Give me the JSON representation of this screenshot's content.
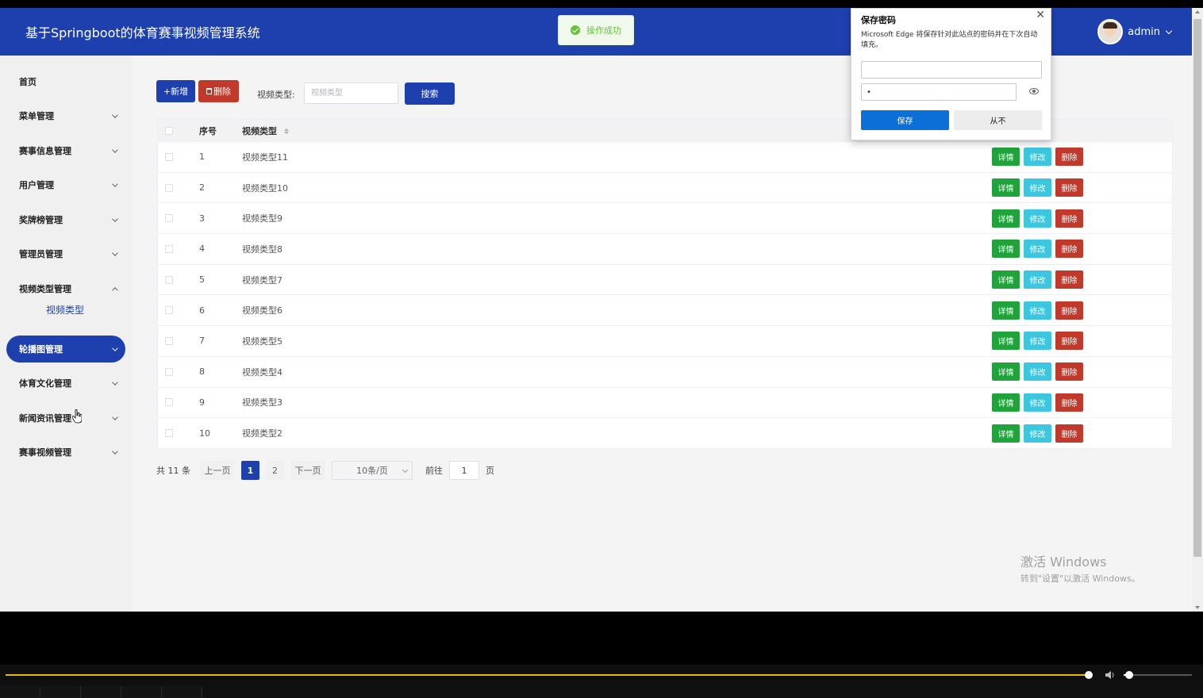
{
  "header": {
    "title": "基于Springboot的体育赛事视频管理系统",
    "user_name": "admin"
  },
  "toast": {
    "message": "操作成功"
  },
  "sidebar": {
    "items": [
      {
        "label": "首页",
        "expandable": false
      },
      {
        "label": "菜单管理",
        "expandable": true
      },
      {
        "label": "赛事信息管理",
        "expandable": true
      },
      {
        "label": "用户管理",
        "expandable": true
      },
      {
        "label": "奖牌榜管理",
        "expandable": true
      },
      {
        "label": "管理员管理",
        "expandable": true
      },
      {
        "label": "视频类型管理",
        "expandable": true,
        "expanded": true
      },
      {
        "label": "轮播图管理",
        "expandable": true,
        "hovered": true
      },
      {
        "label": "体育文化管理",
        "expandable": true
      },
      {
        "label": "新闻资讯管理",
        "expandable": true
      },
      {
        "label": "赛事视频管理",
        "expandable": true
      }
    ],
    "submenu": {
      "label": "视频类型"
    }
  },
  "toolbar": {
    "add_label": "+新增",
    "delete_label": "删除",
    "filter_label": "视频类型:",
    "filter_placeholder": "视频类型",
    "search_label": "搜索"
  },
  "table": {
    "columns": [
      "序号",
      "视频类型"
    ],
    "rows": [
      {
        "index": "1",
        "name": "视频类型11"
      },
      {
        "index": "2",
        "name": "视频类型10"
      },
      {
        "index": "3",
        "name": "视频类型9"
      },
      {
        "index": "4",
        "name": "视频类型8"
      },
      {
        "index": "5",
        "name": "视频类型7"
      },
      {
        "index": "6",
        "name": "视频类型6"
      },
      {
        "index": "7",
        "name": "视频类型5"
      },
      {
        "index": "8",
        "name": "视频类型4"
      },
      {
        "index": "9",
        "name": "视频类型3"
      },
      {
        "index": "10",
        "name": "视频类型2"
      }
    ],
    "actions": {
      "detail": "详情",
      "edit": "修改",
      "delete": "删除"
    }
  },
  "pagination": {
    "total_label": "共 11 条",
    "prev_label": "上一页",
    "pages": [
      "1",
      "2"
    ],
    "current_page": "1",
    "next_label": "下一页",
    "page_size": "10条/页",
    "goto_label": "前往",
    "goto_value": "1",
    "page_unit": "页"
  },
  "password_popup": {
    "title": "保存密码",
    "description": "Microsoft Edge 将保存针对此站点的密码并在下次自动填充。",
    "username_value": "",
    "password_value": "•",
    "save_label": "保存",
    "never_label": "从不"
  },
  "watermark": {
    "title": "激活 Windows",
    "subtitle": "转到\"设置\"以激活 Windows。"
  },
  "colors": {
    "primary": "#1e40af",
    "success": "#1fa33a",
    "info": "#3cc6e0",
    "danger": "#c0392b",
    "player_progress": "#e8b90c"
  },
  "player": {
    "progress": 0.9,
    "volume": 0.08
  }
}
